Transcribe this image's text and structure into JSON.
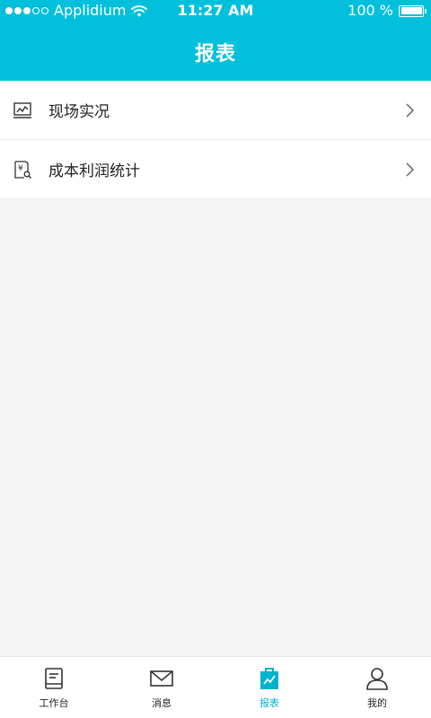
{
  "status_bar": {
    "carrier": "Applidium",
    "time": "11:27 AM",
    "battery": "100 %",
    "battery_level": 1.0
  },
  "header": {
    "title": "报表"
  },
  "menu": {
    "items": [
      {
        "label": "现场实况",
        "icon": "line-chart-icon"
      },
      {
        "label": "成本利润统计",
        "icon": "yen-document-icon"
      }
    ]
  },
  "tabbar": {
    "active_color": "#00b2d0",
    "items": [
      {
        "label": "工作台",
        "icon": "workbench-icon"
      },
      {
        "label": "消息",
        "icon": "mail-icon"
      },
      {
        "label": "报表",
        "icon": "report-icon",
        "active": true
      },
      {
        "label": "我的",
        "icon": "user-icon"
      }
    ]
  },
  "colors": {
    "brand": "#00c0dc",
    "background": "#f6f5f6"
  }
}
